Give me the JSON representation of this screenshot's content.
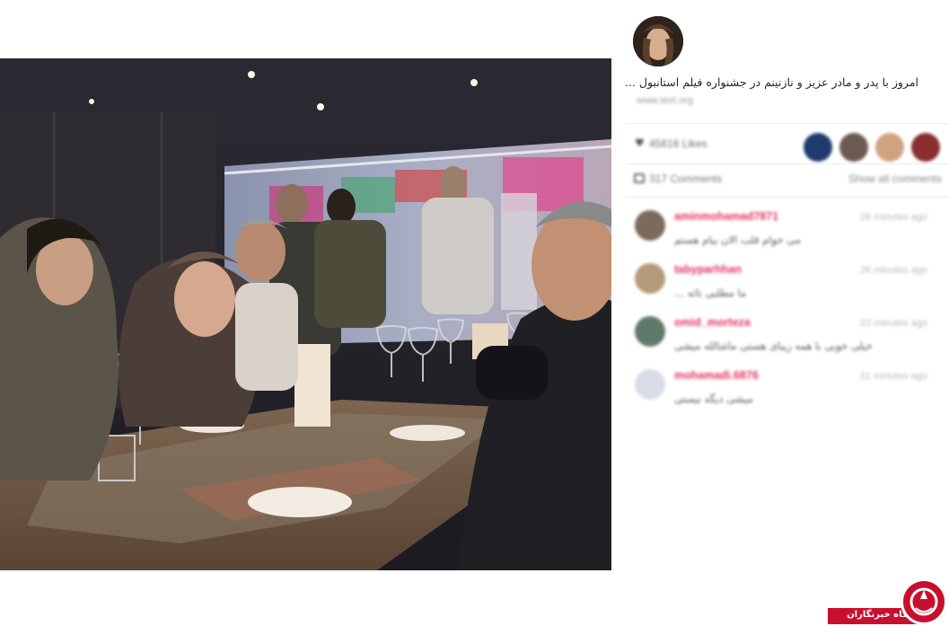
{
  "post": {
    "caption": "امروز با پدر و مادر عزیز و نازنینم در جشنواره فیلم استانبول ...",
    "caption_sub": "www.text.org"
  },
  "likes": {
    "count_label": "45616 Likes"
  },
  "comments_bar": {
    "count_label": "317 Comments",
    "show_all_label": "Show all comments"
  },
  "comments": [
    {
      "username": "aminmohamad7871",
      "time": "26 minutes ago",
      "text": "می خوام قلب الان بیام هستم"
    },
    {
      "username": "tabyparhhan",
      "time": "26 minutes ago",
      "text": "ما مطلبی تاثه ..."
    },
    {
      "username": "omid_morteza",
      "time": "23 minutes ago",
      "text": "خیلی خوبی با همه زیبای هستی ماشالله میشی"
    },
    {
      "username": "mohamadi.6876",
      "time": "21 minutes ago",
      "text": "میشی دیگه نیستی"
    }
  ],
  "badge": {
    "text": "باشگاه خبرنگاران"
  },
  "icons": {
    "likes": "heart-icon",
    "comments": "comment-icon",
    "badge_logo": "news-agency-logo"
  },
  "colors": {
    "username": "#e0355e",
    "badge_red": "#c8102e"
  }
}
